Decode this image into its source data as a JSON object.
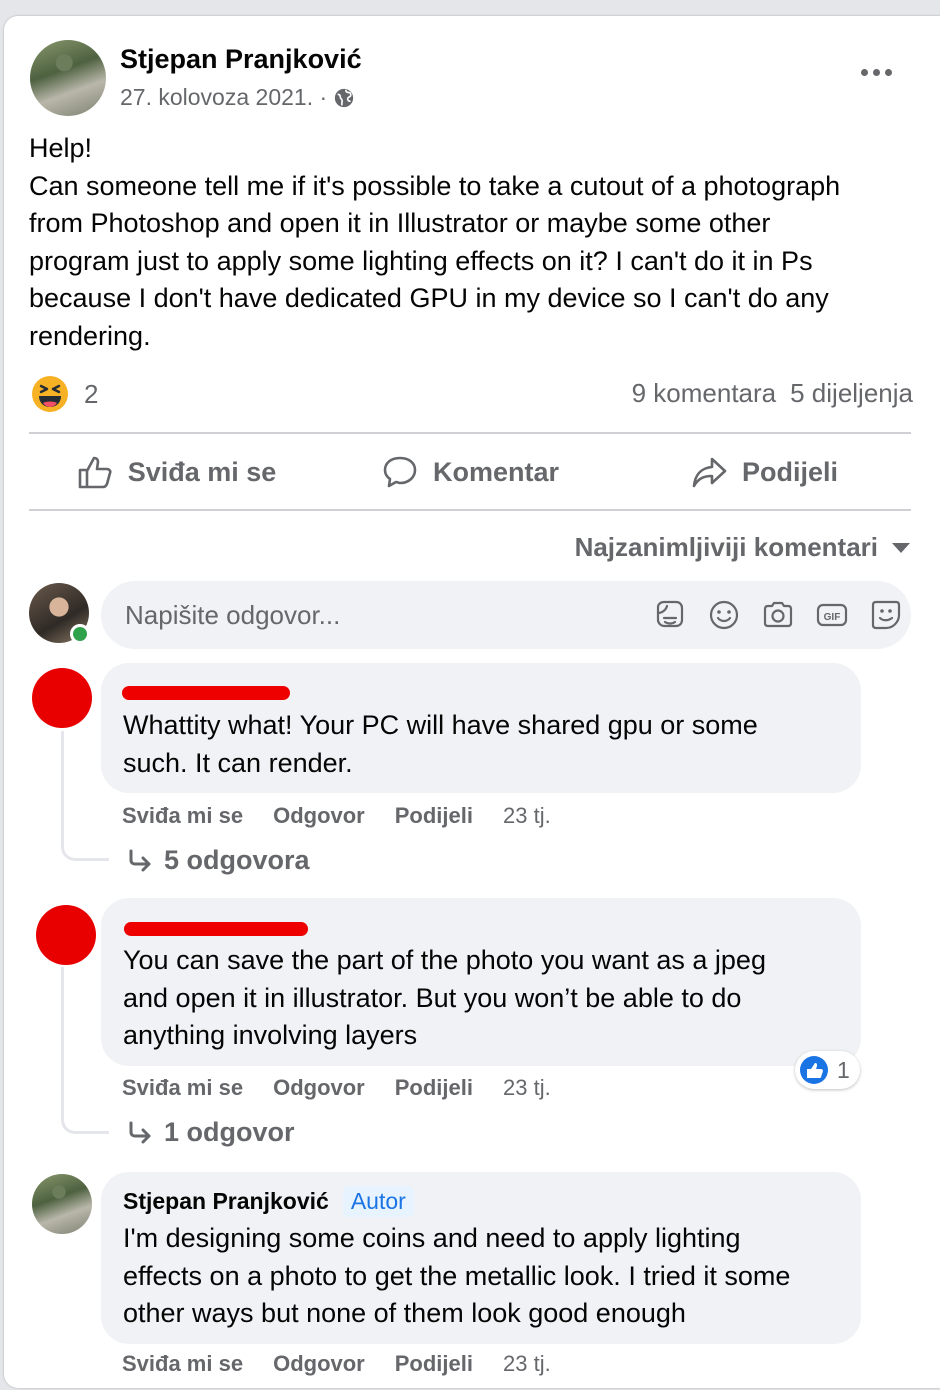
{
  "post": {
    "author": "Stjepan Pranjković",
    "date": "27. kolovoza 2021. ·",
    "text_lines": [
      "Help!",
      "Can someone tell me if it's possible to take a cutout of a photograph",
      "from Photoshop and open it in Illustrator or maybe some other",
      "program just to apply some lighting effects on it? I can't do it in Ps",
      "because I don't have dedicated GPU in my device so I can't do any",
      "rendering."
    ],
    "reaction_count": "2",
    "comments_count": "9 komentara",
    "shares_count": "5 dijeljenja"
  },
  "actions": {
    "like": "Sviđa mi se",
    "comment": "Komentar",
    "share": "Podijeli"
  },
  "sort_label": "Najzanimljiviji komentari",
  "reply": {
    "placeholder": "Napišite odgovor..."
  },
  "comments": [
    {
      "author": "",
      "text_lines": [
        "Whattity what! Your PC will have shared gpu or some",
        "such. It can render."
      ],
      "like": "Sviđa mi se",
      "reply": "Odgovor",
      "share": "Podijeli",
      "time": "23 tj.",
      "replies": "5 odgovora"
    },
    {
      "author": "",
      "text_lines": [
        "You can save the part of the photo you want as a jpeg",
        "and open it in illustrator. But you won’t be able to do",
        "anything involving layers"
      ],
      "like": "Sviđa mi se",
      "reply": "Odgovor",
      "share": "Podijeli",
      "time": "23 tj.",
      "replies": "1 odgovor",
      "like_count": "1"
    },
    {
      "author": "Stjepan Pranjković",
      "badge": "Autor",
      "text_lines": [
        "I'm designing some coins and need to apply lighting",
        "effects on a photo to get the metallic look. I tried it some",
        "other ways but none of them look good enough"
      ],
      "like": "Sviđa mi se",
      "reply": "Odgovor",
      "share": "Podijeli",
      "time": "23 tj."
    }
  ],
  "colors": {
    "secondary_text": "#65676b",
    "accent": "#1b74e4",
    "online": "#31a24c",
    "redaction": "#ee0000"
  }
}
